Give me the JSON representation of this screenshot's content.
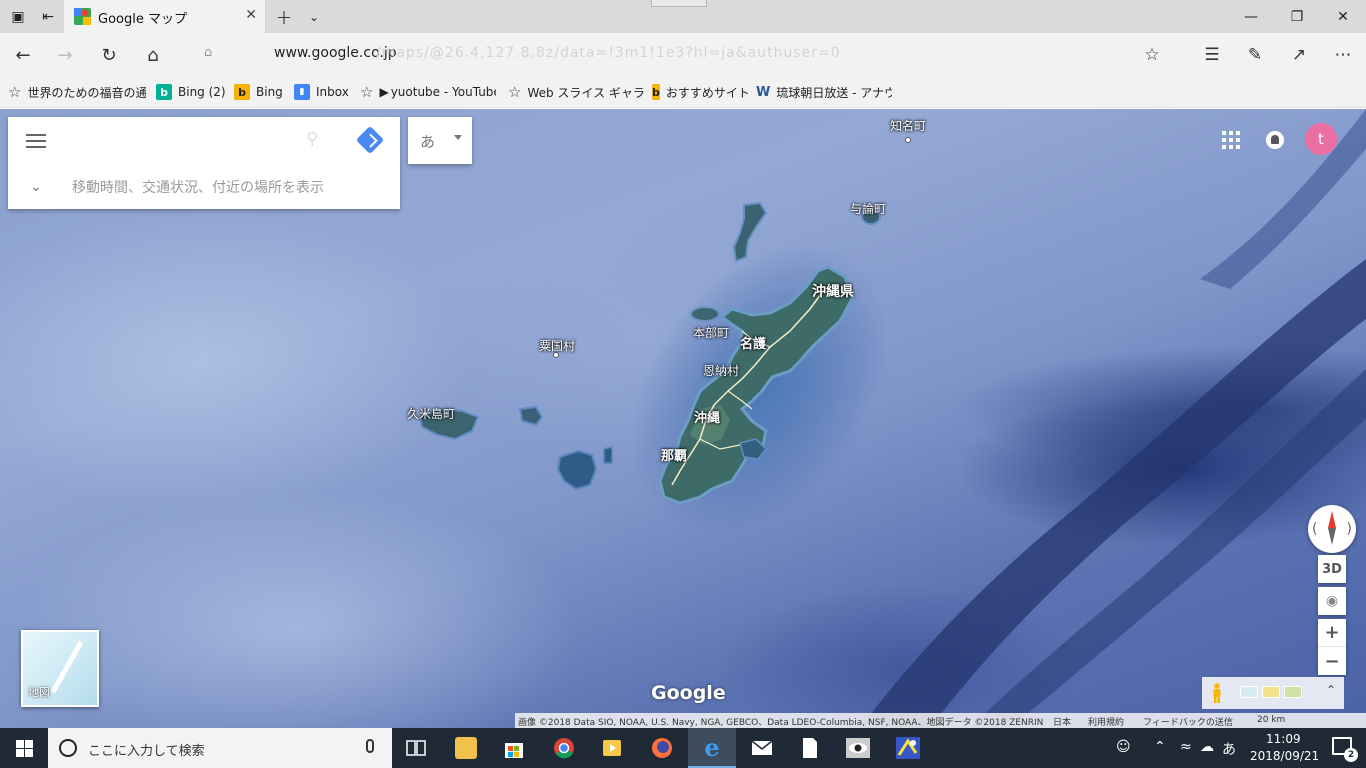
{
  "browser": {
    "tab": {
      "title": "Google マップ"
    },
    "address": {
      "host": "www.google.co.jp",
      "path": "/maps/@26.4,127.8,8z/data=!3m1!1e3?hl=ja&authuser=0"
    },
    "favorites": [
      {
        "icon": "star-icon",
        "label": "世界のための福音の通信"
      },
      {
        "icon": "bing-translate-icon",
        "label": "Bing (2)"
      },
      {
        "icon": "bing-icon",
        "label": "Bing"
      },
      {
        "icon": "inbox-icon",
        "label": "Inbox"
      },
      {
        "icon": "star-icon",
        "label": "yuotube - YouTube"
      },
      {
        "icon": "star-icon",
        "label": "Web スライス ギャラリー"
      },
      {
        "icon": "bing-icon",
        "label": "おすすめサイト"
      },
      {
        "icon": "word-icon",
        "label": "琉球朝日放送 - アナウ"
      }
    ]
  },
  "map": {
    "search": {
      "placeholder": "",
      "expand_text": "移動時間、交通状況、付近の場所を表示"
    },
    "ime_label": "あ",
    "avatar_letter": "t",
    "controls": {
      "three_d": "3D",
      "zoom_in": "+",
      "zoom_out": "−",
      "tray_expand": "⌃"
    },
    "thumb_label": "地図",
    "google_logo": "Google",
    "places": {
      "china_town": "知名町",
      "yoron": "与論町",
      "okinawa_pref": "沖縄県",
      "motobu": "本部町",
      "nago": "名護",
      "aguni": "粟国村",
      "onna": "恩納村",
      "kumejima": "久米島町",
      "okinawa_city": "沖縄",
      "naha": "那覇"
    },
    "attribution": {
      "imagery": "画像 ©2018 Data SIO, NOAA, U.S. Navy, NGA, GEBCO、Data LDEO-Columbia, NSF, NOAA、地図データ ©2018 ZENRIN",
      "japan": "日本",
      "terms": "利用規約",
      "feedback": "フィードバックの送信",
      "scale": "20 km"
    }
  },
  "taskbar": {
    "search_text": "ここに入力して検索",
    "ime_indicator": "あ",
    "time": "11:09",
    "date": "2018/09/21",
    "notification_count": "2"
  }
}
